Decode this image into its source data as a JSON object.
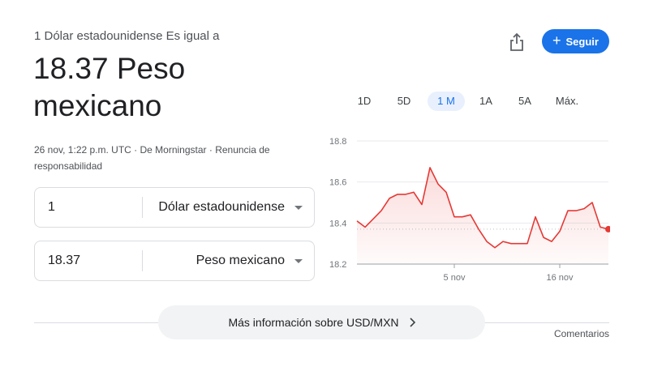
{
  "header": {
    "subtitle": "1 Dólar estadounidense Es igual a",
    "big_value": "18.37 Peso mexicano",
    "meta": "26 nov, 1:22 p.m. UTC · De Morningstar · Renuncia de responsabilidad"
  },
  "actions": {
    "share_icon": "share-icon",
    "follow_label": "Seguir",
    "accent_color": "#1a73e8"
  },
  "converter": {
    "from_amount": "1",
    "from_currency": "Dólar estadounidense",
    "to_amount": "18.37",
    "to_currency": "Peso mexicano"
  },
  "ranges": [
    "1D",
    "5D",
    "1 M",
    "1A",
    "5A",
    "Máx."
  ],
  "active_range": "1 M",
  "chart_data": {
    "type": "area",
    "line_color": "#e53935",
    "y_ticks": [
      "18.8",
      "18.6",
      "18.4",
      "18.2"
    ],
    "ylim": [
      18.2,
      18.8
    ],
    "x_tick_labels": [
      {
        "label": "5 nov",
        "index": 12
      },
      {
        "label": "16 nov",
        "index": 25
      }
    ],
    "baseline": 18.37,
    "values": [
      18.41,
      18.38,
      18.42,
      18.46,
      18.52,
      18.54,
      18.54,
      18.55,
      18.49,
      18.67,
      18.59,
      18.55,
      18.43,
      18.43,
      18.44,
      18.37,
      18.31,
      18.28,
      18.31,
      18.3,
      18.3,
      18.3,
      18.43,
      18.33,
      18.31,
      18.36,
      18.46,
      18.46,
      18.47,
      18.5,
      18.38,
      18.37
    ]
  },
  "footer": {
    "more_info": "Más información sobre USD/MXN",
    "feedback": "Comentarios"
  }
}
